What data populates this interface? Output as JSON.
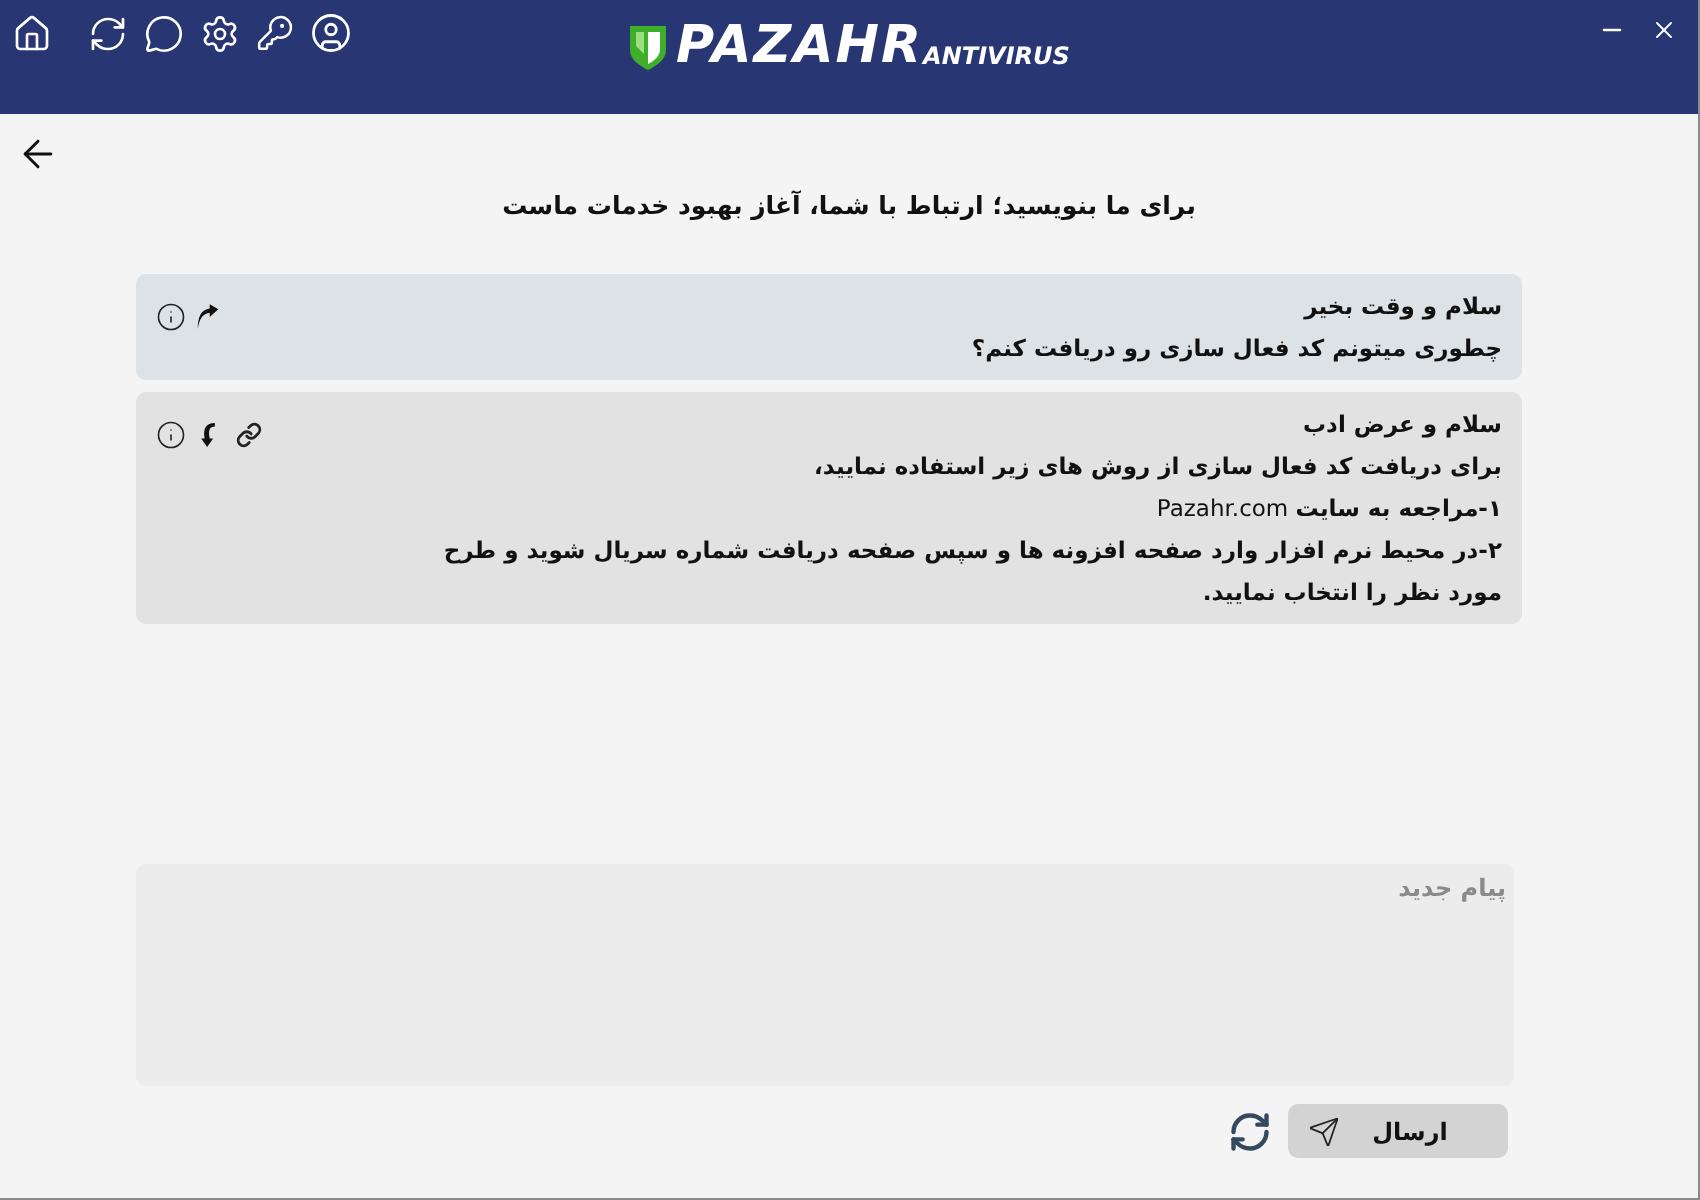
{
  "window": {
    "logo_name": "PAZAHR",
    "logo_suffix": "ANTIVIRUS"
  },
  "page": {
    "title": "برای ما بنویسید؛ ارتباط با شما، آغاز بهبود خدمات ماست"
  },
  "messages": [
    {
      "kind": "sent",
      "lines": [
        {
          "kind": "bold",
          "text": "سلام و وقت بخیر"
        },
        {
          "kind": "bold",
          "text": "چطوری میتونم کد فعال سازی رو دریافت کنم؟"
        }
      ]
    },
    {
      "kind": "received",
      "lines": [
        {
          "kind": "bold",
          "text": "سلام و عرض ادب"
        },
        {
          "kind": "bold",
          "text": "برای دریافت کد فعال سازی از روش های زیر استفاده نمایید،"
        },
        {
          "kind": "mixed",
          "text": "**۱-مراجعه به سایت** Pazahr.com"
        },
        {
          "kind": "bold",
          "text": "۲-در محیط نرم افزار وارد صفحه افزونه ها و سپس صفحه دریافت شماره سریال شوید و طرح مورد نظر را انتخاب نمایید."
        }
      ]
    }
  ],
  "composer": {
    "placeholder": "پیام جدید"
  },
  "send_button": {
    "label": "ارسال"
  }
}
